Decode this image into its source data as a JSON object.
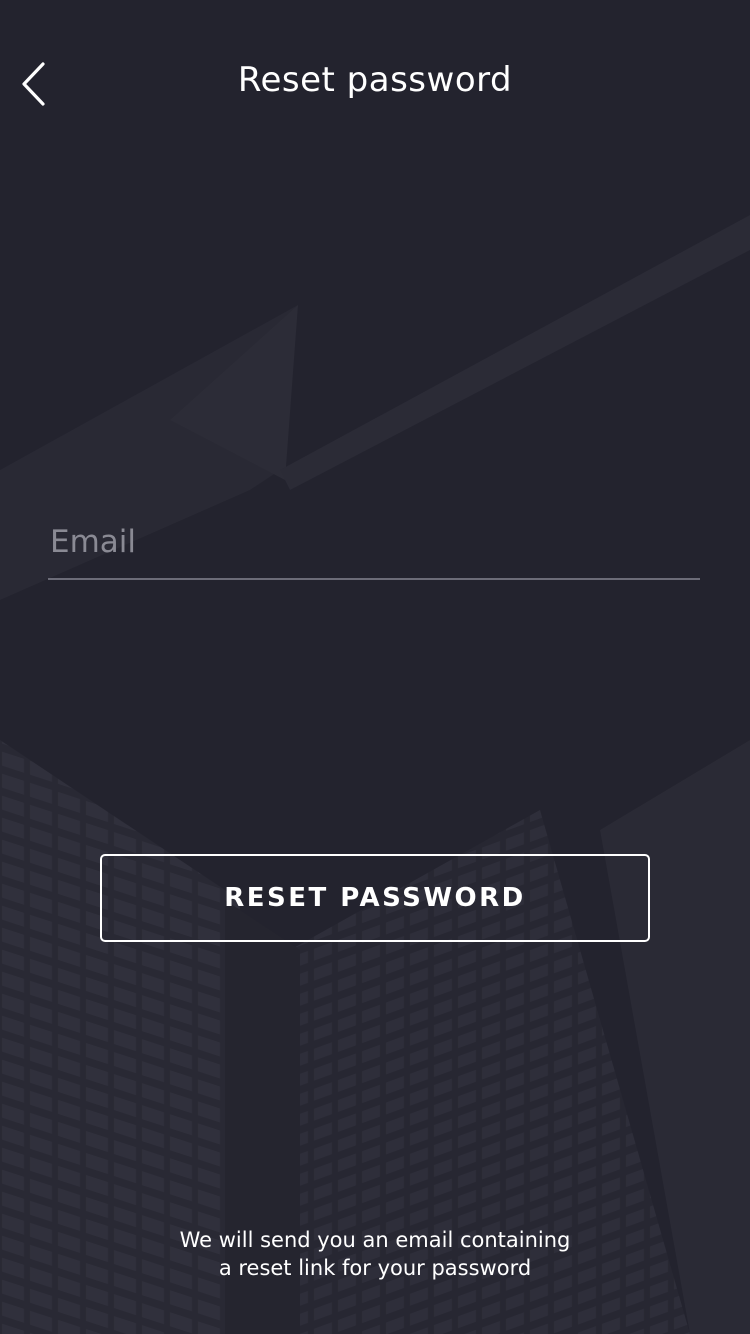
{
  "header": {
    "title": "Reset password",
    "back_icon": "chevron-left-icon"
  },
  "form": {
    "email_placeholder": "Email",
    "email_value": ""
  },
  "actions": {
    "reset_label": "RESET PASSWORD"
  },
  "info": {
    "line_1": "We will send you an email containing",
    "line_2": "a reset link for your password"
  },
  "colors": {
    "background": "#23232e",
    "text": "#ffffff",
    "placeholder": "#8a8a94",
    "underline": "#6c6c78"
  }
}
